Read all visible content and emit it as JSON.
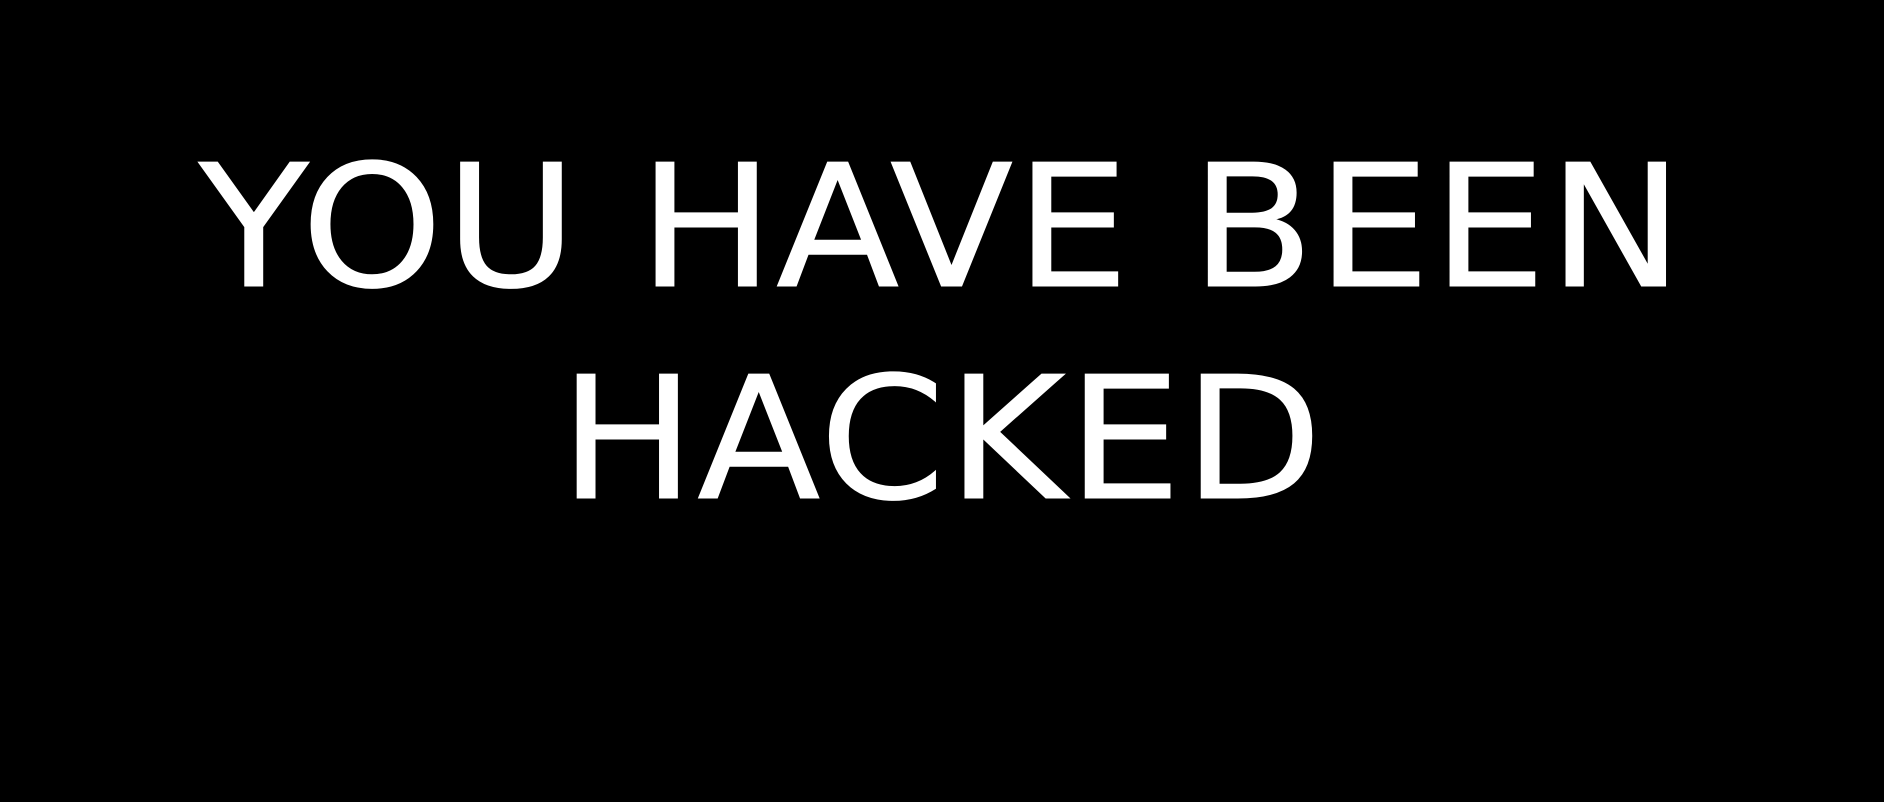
{
  "message": {
    "line1": "YOU HAVE BEEN",
    "line2": "HACKED"
  },
  "colors": {
    "background": "#000000",
    "text": "#ffffff"
  }
}
